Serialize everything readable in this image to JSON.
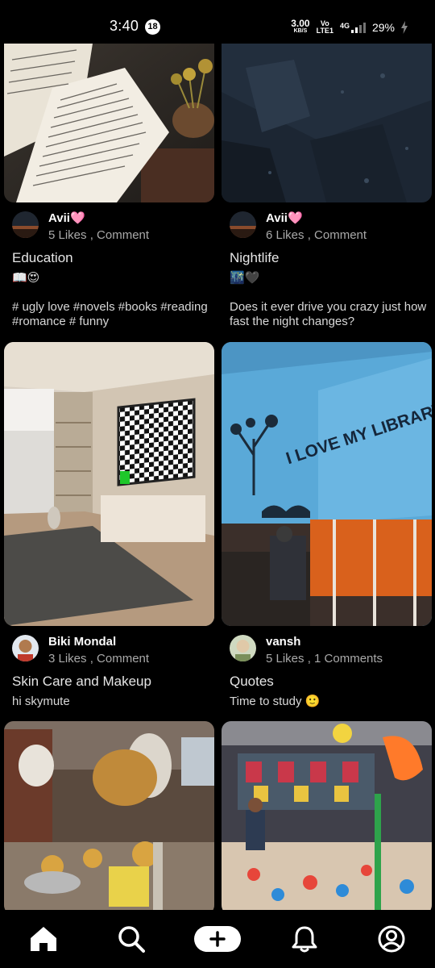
{
  "status_bar": {
    "time": "3:40",
    "notification_count": "18",
    "net_speed_value": "3.00",
    "net_speed_unit": "KB/S",
    "volte_top": "Vo",
    "volte_bottom": "LTE1",
    "network": "4G",
    "battery": "29%"
  },
  "posts": [
    {
      "user": "Avii🩷",
      "stats": "5 Likes , Comment",
      "title": "Education",
      "emoji_line": "📖😍",
      "description": "# ugly love #novels #books #reading #romance # funny"
    },
    {
      "user": "Avii🩷",
      "stats": "6 Likes , Comment",
      "title": "Nightlife",
      "emoji_line": "🌃🖤",
      "description": "Does it ever drive you crazy just how fast the night changes?"
    },
    {
      "user": "Biki Mondal",
      "stats": "3 Likes , Comment",
      "title": "Skin Care and Makeup",
      "description": "hi skymute"
    },
    {
      "user": "vansh",
      "stats": "5 Likes , 1 Comments",
      "title": "Quotes",
      "description": "Time to study 🙂"
    }
  ],
  "photos": {
    "library_wall_text": "I LOVE MY LIBRARY"
  },
  "nav": {
    "items": [
      "home-icon",
      "search-icon",
      "create-icon",
      "bell-icon",
      "profile-icon"
    ]
  },
  "colors": {
    "background": "#000000",
    "muted_text": "#a9a9a9"
  }
}
